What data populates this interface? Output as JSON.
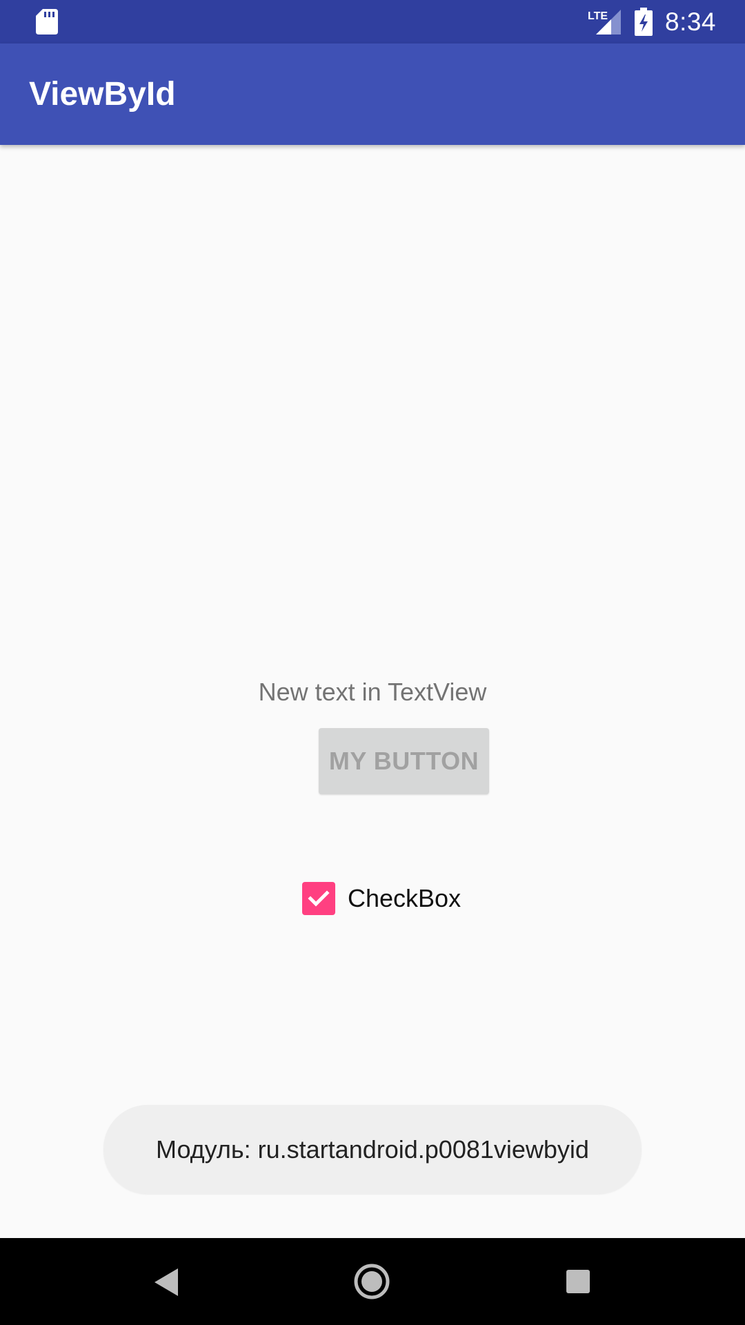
{
  "status_bar": {
    "time": "8:34",
    "network_label": "LTE",
    "icons": [
      "sd-card-icon",
      "lte-signal-icon",
      "battery-charging-icon"
    ]
  },
  "app_bar": {
    "title": "ViewById"
  },
  "content": {
    "text_view": "New text in TextView",
    "button_label": "MY BUTTON",
    "checkbox": {
      "label": "CheckBox",
      "checked": true
    }
  },
  "toast": {
    "message": "Модуль: ru.startandroid.p0081viewbyid"
  },
  "nav_bar": {
    "icons": [
      "back-icon",
      "home-icon",
      "recents-icon"
    ]
  },
  "colors": {
    "status_bar": "#303f9f",
    "app_bar": "#3f51b5",
    "accent": "#ff4081",
    "background": "#fafafa",
    "button": "#d6d7d7",
    "toast": "#efefef",
    "nav_bar": "#000000"
  }
}
